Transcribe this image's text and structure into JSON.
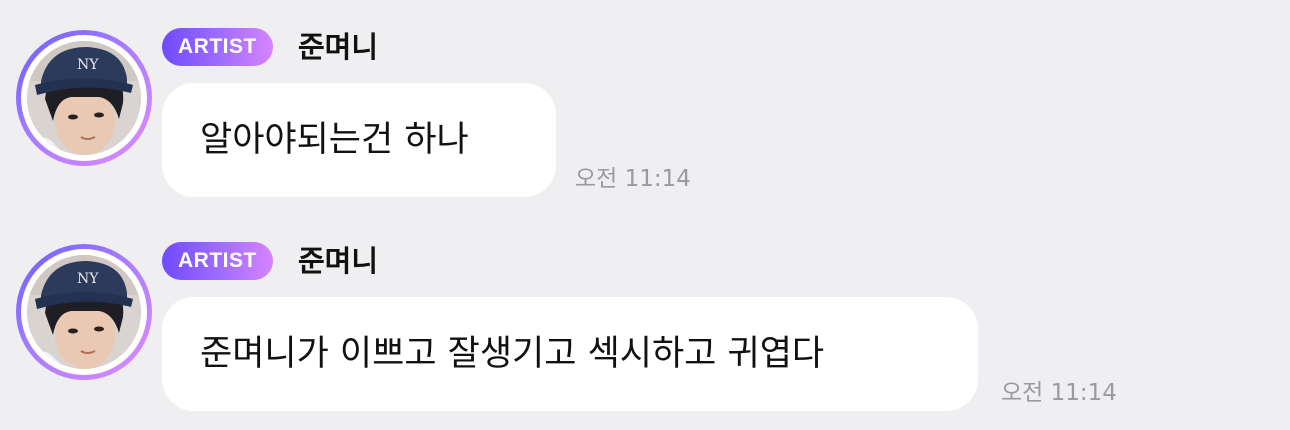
{
  "colors": {
    "background": "#efeff1",
    "bubble": "#ffffff",
    "badge_gradient": [
      "#6f4bff",
      "#d684ff"
    ],
    "timestamp": "#9a9a9e"
  },
  "messages": [
    {
      "badge": "ARTIST",
      "sender": "준며니",
      "text": "알아야되는건 하나",
      "time": "오전 11:14",
      "avatar_icon": "profile-photo-navy-cap"
    },
    {
      "badge": "ARTIST",
      "sender": "준며니",
      "text": "준며니가 이쁘고 잘생기고 섹시하고 귀엽다",
      "time": "오전 11:14",
      "avatar_icon": "profile-photo-navy-cap"
    }
  ]
}
